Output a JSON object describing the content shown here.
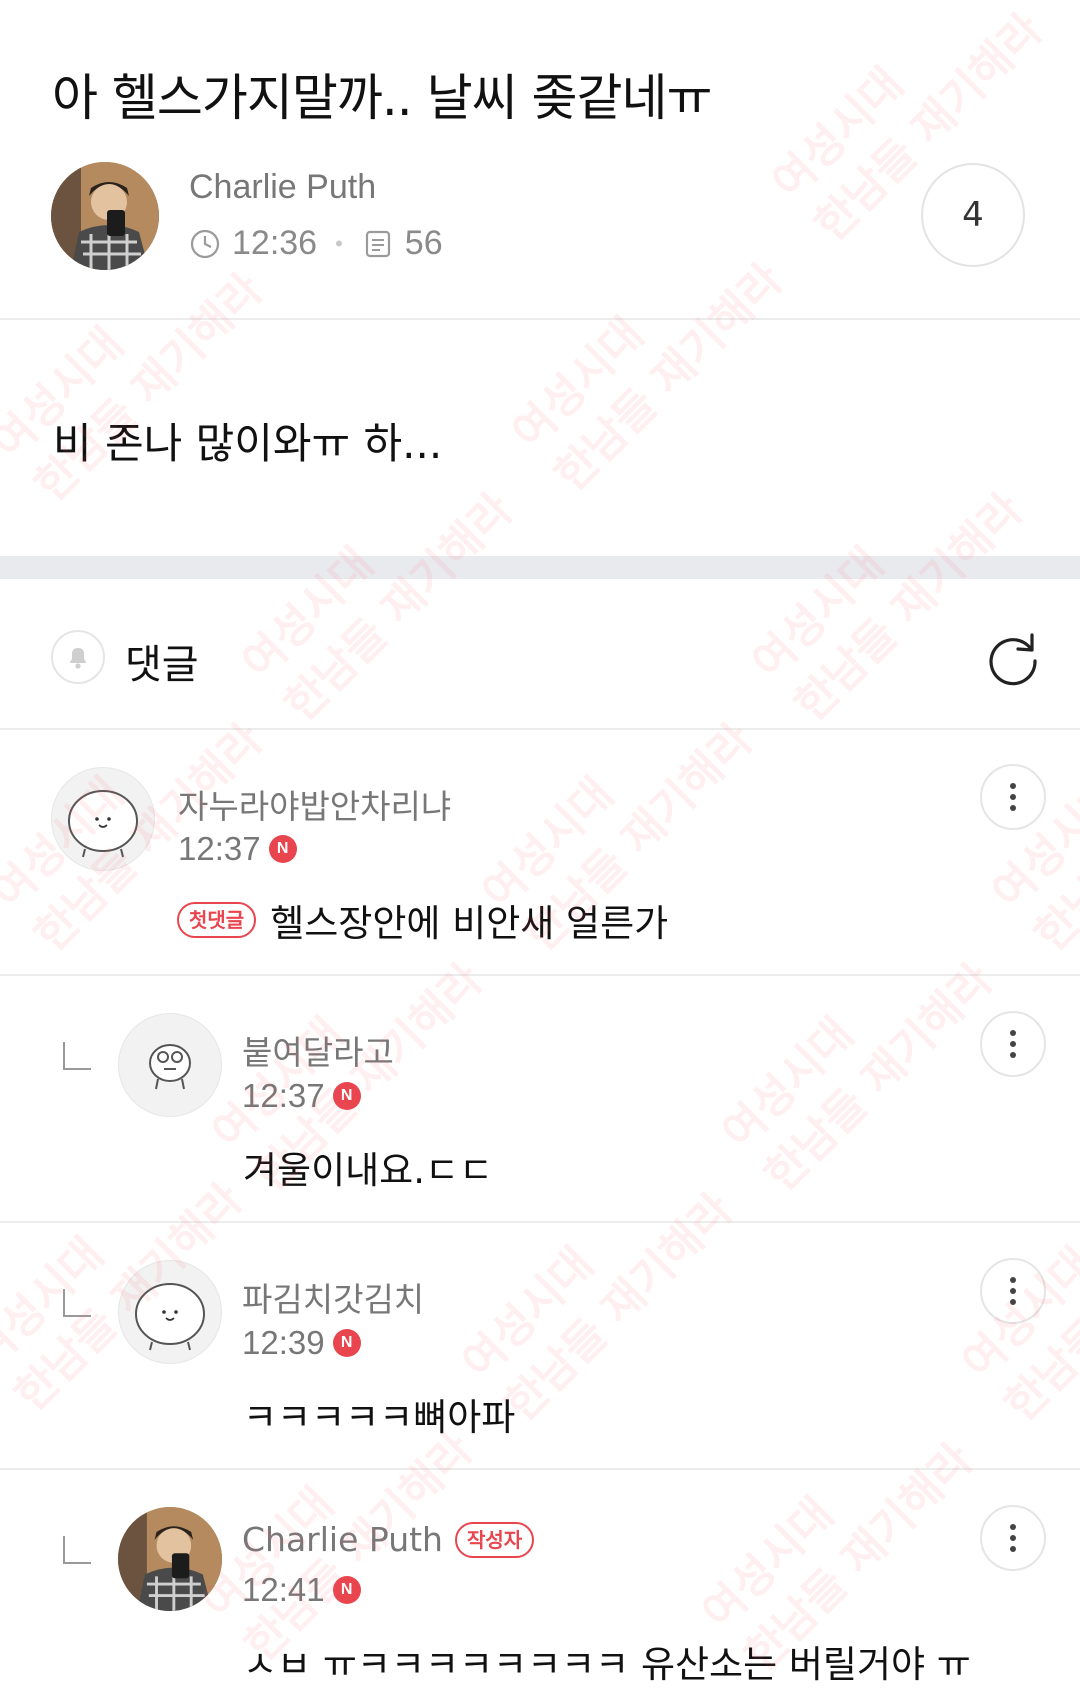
{
  "post": {
    "title": "아 헬스가지말까.. 날씨 좆같네ㅠ",
    "author": "Charlie Puth",
    "time": "12:36",
    "views": "56",
    "comment_count": "4",
    "body": "비 존나 많이와ㅠ 하..."
  },
  "comments_header": {
    "title": "댓글"
  },
  "comments": [
    {
      "name": "자누라야밥안차리냐",
      "time": "12:37",
      "badge": "N",
      "tag": "첫댓글",
      "text": "헬스장안에 비안새 얼른가"
    },
    {
      "name": "붙여달라고",
      "time": "12:37",
      "badge": "N",
      "text": "겨울이내요.ㄷㄷ"
    },
    {
      "name": "파김치갓김치",
      "time": "12:39",
      "badge": "N",
      "text": "ㅋㅋㅋㅋㅋ뼈아파"
    },
    {
      "name": "Charlie Puth",
      "author_tag": "작성자",
      "time": "12:41",
      "badge": "N",
      "text": "ㅅㅂ ㅠㅋㅋㅋㅋㅋㅋㅋㅋ 유산소는 버릴거야 ㅠ"
    }
  ],
  "watermark": {
    "line1": "여성시대",
    "line2": "한남들 재기해라"
  },
  "colors": {
    "accent": "#e8454f",
    "divider": "#ececec",
    "band": "#e9eaee"
  }
}
